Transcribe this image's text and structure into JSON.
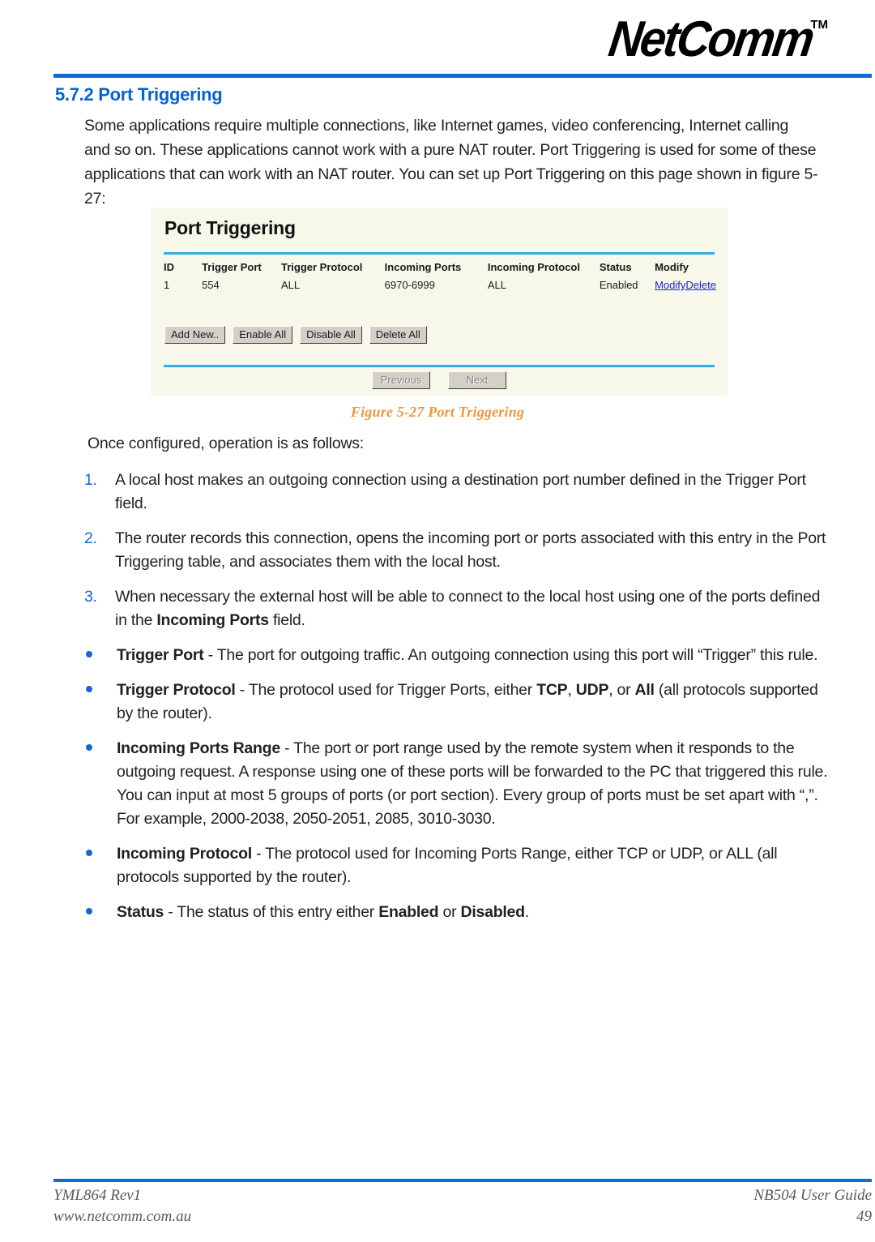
{
  "header": {
    "logo_text": "NetComm",
    "logo_tm": "TM",
    "rule_color": "#1169d3"
  },
  "section": {
    "number_and_title": "5.7.2 Port Triggering",
    "heading_color": "#0a62ce"
  },
  "intro": {
    "paragraph": "Some applications require multiple connections, like Internet games, video conferencing, Internet calling and so on. These applications cannot work with a pure NAT router. Port Triggering is used for some of these applications that can work with an NAT router. You can set up Port Triggering on this page shown in figure 5-27:"
  },
  "figure": {
    "caption": "Figure 5-27 Port Triggering",
    "caption_color": "#f0973c",
    "panel_background": "#f7f7ea",
    "divider_color": "#35aee4",
    "ui": {
      "title": "Port Triggering",
      "columns": [
        "ID",
        "Trigger Port",
        "Trigger Protocol",
        "Incoming Ports",
        "Incoming Protocol",
        "Status",
        "Modify"
      ],
      "rows": [
        {
          "id": "1",
          "trigger_port": "554",
          "trigger_protocol": "ALL",
          "incoming_ports": "6970-6999",
          "incoming_protocol": "ALL",
          "status": "Enabled",
          "modify_link": "Modify",
          "delete_link": "Delete"
        }
      ],
      "action_buttons": [
        "Add New..",
        "Enable All",
        "Disable All",
        "Delete All"
      ],
      "nav_buttons": [
        "Previous",
        "Next"
      ],
      "link_color": "#2020cc"
    }
  },
  "operation": {
    "lead_in": "Once configured, operation is as follows:",
    "numbered_items": [
      {
        "marker": "1.",
        "text": "A local host makes an outgoing connection using a destination port number defined in the Trigger Port field."
      },
      {
        "marker": "2.",
        "text": "The router records this connection, opens the incoming port or ports associated with this entry in the Port Triggering table, and associates them with the local host."
      },
      {
        "marker": "3.",
        "text_prefix": "When necessary the external host will be able to connect to the local host using one of the ports defined in the ",
        "text_bold": "Incoming Ports",
        "text_suffix": " field."
      }
    ],
    "bullet_items": [
      {
        "term": "Trigger Port",
        "body": " - The port for outgoing traffic. An outgoing connection using this port will “Trigger” this rule."
      },
      {
        "term": "Trigger Protocol",
        "body_1": " - The protocol used for Trigger Ports, either ",
        "bold_1": "TCP",
        "body_2": ", ",
        "bold_2": "UDP",
        "body_3": ", or ",
        "bold_3": "All",
        "body_4": " (all protocols supported by the router)."
      },
      {
        "term": "Incoming Ports Range",
        "body": " - The port or port range used by the remote system when it responds to the outgoing request. A response using one of these ports will be forwarded to the PC that triggered this rule. You can input at most 5 groups of ports (or port section). Every group of ports must be set apart with “,”. For example, 2000-2038, 2050-2051, 2085, 3010-3030."
      },
      {
        "term": "Incoming Protocol",
        "body": " - The protocol used for Incoming Ports Range, either TCP or UDP, or ALL (all protocols supported by the router)."
      },
      {
        "term": "Status",
        "body_1": " - The status of this entry either ",
        "bold_1": "Enabled",
        "body_2": " or ",
        "bold_2": "Disabled",
        "body_3": "."
      }
    ],
    "marker_color": "#1268d0"
  },
  "footer": {
    "left_line_1": "YML864 Rev1",
    "left_line_2": "www.netcomm.com.au",
    "right_line_1": "NB504 User Guide",
    "right_line_2": "49"
  }
}
